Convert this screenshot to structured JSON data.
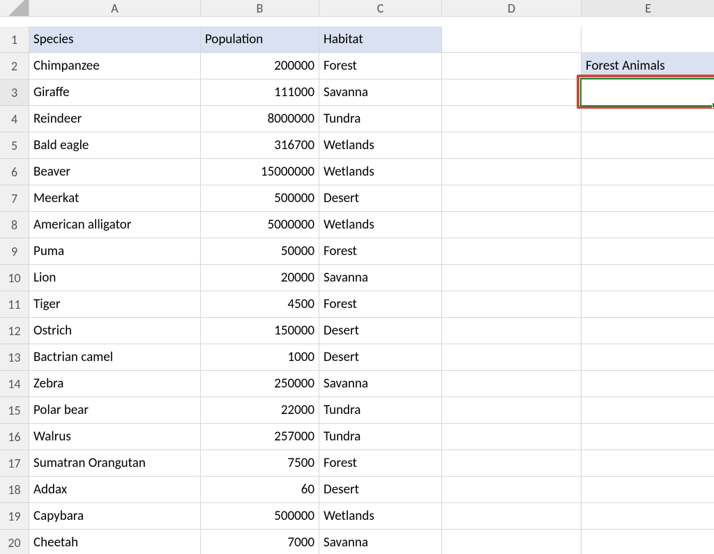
{
  "columns": [
    "A",
    "B",
    "C",
    "D",
    "E"
  ],
  "row_numbers": [
    1,
    2,
    3,
    4,
    5,
    6,
    7,
    8,
    9,
    10,
    11,
    12,
    13,
    14,
    15,
    16,
    17,
    18,
    19,
    20
  ],
  "headers": {
    "A": "Species",
    "B": "Population",
    "C": "Habitat"
  },
  "side_header": "Forest Animals",
  "active_cell": "E3",
  "rows": [
    {
      "species": "Chimpanzee",
      "population": "200000",
      "habitat": "Forest"
    },
    {
      "species": "Giraffe",
      "population": "111000",
      "habitat": "Savanna"
    },
    {
      "species": "Reindeer",
      "population": "8000000",
      "habitat": "Tundra"
    },
    {
      "species": "Bald eagle",
      "population": "316700",
      "habitat": "Wetlands"
    },
    {
      "species": "Beaver",
      "population": "15000000",
      "habitat": "Wetlands"
    },
    {
      "species": "Meerkat",
      "population": "500000",
      "habitat": "Desert"
    },
    {
      "species": "American alligator",
      "population": "5000000",
      "habitat": "Wetlands"
    },
    {
      "species": "Puma",
      "population": "50000",
      "habitat": "Forest"
    },
    {
      "species": "Lion",
      "population": "20000",
      "habitat": "Savanna"
    },
    {
      "species": "Tiger",
      "population": "4500",
      "habitat": "Forest"
    },
    {
      "species": "Ostrich",
      "population": "150000",
      "habitat": "Desert"
    },
    {
      "species": "Bactrian camel",
      "population": "1000",
      "habitat": "Desert"
    },
    {
      "species": "Zebra",
      "population": "250000",
      "habitat": "Savanna"
    },
    {
      "species": "Polar bear",
      "population": "22000",
      "habitat": "Tundra"
    },
    {
      "species": "Walrus",
      "population": "257000",
      "habitat": "Tundra"
    },
    {
      "species": "Sumatran Orangutan",
      "population": "7500",
      "habitat": "Forest"
    },
    {
      "species": "Addax",
      "population": "60",
      "habitat": "Desert"
    },
    {
      "species": "Capybara",
      "population": "500000",
      "habitat": "Wetlands"
    },
    {
      "species": "Cheetah",
      "population": "7000",
      "habitat": "Savanna"
    }
  ]
}
